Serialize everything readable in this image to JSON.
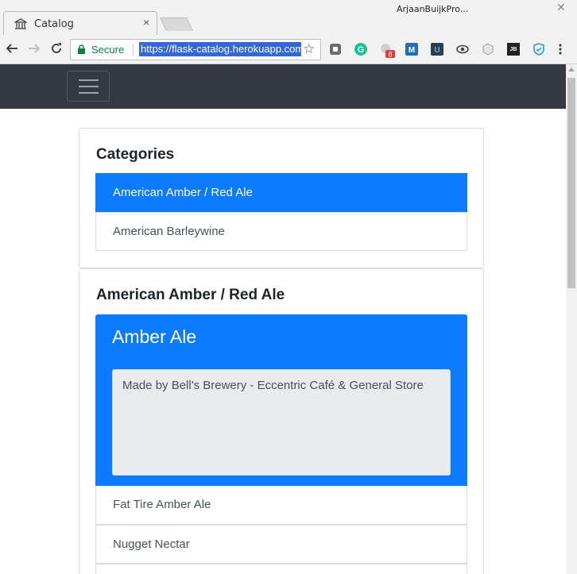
{
  "browser": {
    "tab_title": "Catalog",
    "tab_close": "×",
    "profile_name": "ArjaanBuijkPro...",
    "window_close": "✕",
    "secure_label": "Secure",
    "url": "https://flask-catalog.herokuapp.com",
    "extension_badge": "8"
  },
  "categories_card": {
    "title": "Categories",
    "items": [
      {
        "label": "American Amber / Red Ale",
        "active": true
      },
      {
        "label": "American Barleywine",
        "active": false
      }
    ]
  },
  "items_card": {
    "title": "American Amber / Red Ale",
    "selected": {
      "name": "Amber Ale",
      "description": "Made by Bell's Brewery - Eccentric Café & General Store"
    },
    "items": [
      {
        "label": "Fat Tire Amber Ale"
      },
      {
        "label": "Nugget Nectar"
      }
    ]
  },
  "colors": {
    "navbar": "#343a40",
    "accent": "#0d7bff",
    "secure_green": "#0b8043"
  }
}
